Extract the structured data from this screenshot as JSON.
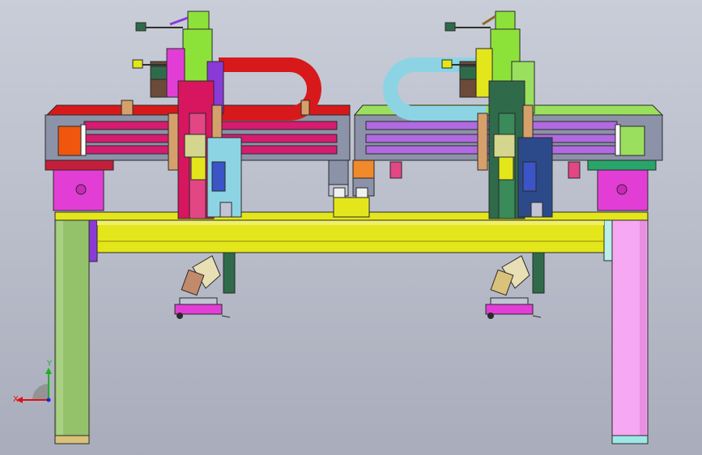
{
  "window": {
    "background_top": "#c9cdd8",
    "background_bottom": "#a9adbb"
  },
  "triad": {
    "x_label": "X",
    "y_label": "Y",
    "x_color": "#e01010",
    "y_color": "#20b020",
    "z_color": "#2020e0"
  },
  "colors": {
    "frame_yellow": "#e4e61c",
    "leg_left": "#94c26b",
    "leg_right": "#f7a8f2",
    "motor_green": "#8de23a",
    "carriage_red": "#d8155f",
    "carriage_dark": "#2f6b4a",
    "rail_pink": "#d61c70",
    "rail_purple": "#b06be0",
    "cable_red": "#d8191b",
    "cable_cyan": "#8cd4e4",
    "plate_gray": "#8c93a8",
    "block_magenta": "#e23ed6"
  }
}
